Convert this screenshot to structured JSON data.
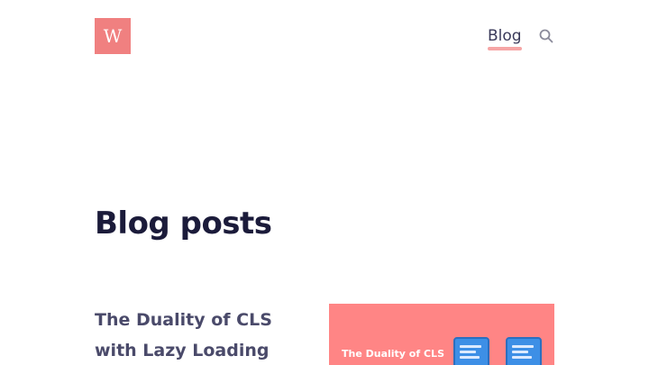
{
  "header": {
    "logo_letter": "W",
    "nav": {
      "blog_label": "Blog"
    },
    "search_icon": "search-icon"
  },
  "main": {
    "title": "Blog posts",
    "posts": [
      {
        "title": "The Duality of CLS with Lazy Loading",
        "thumbnail_text": "The Duality of CLS",
        "thumbnail_color": "#ff8585"
      }
    ]
  },
  "colors": {
    "accent": "#f08080",
    "underline": "#f6a5a5",
    "heading": "#1b1b3a"
  }
}
